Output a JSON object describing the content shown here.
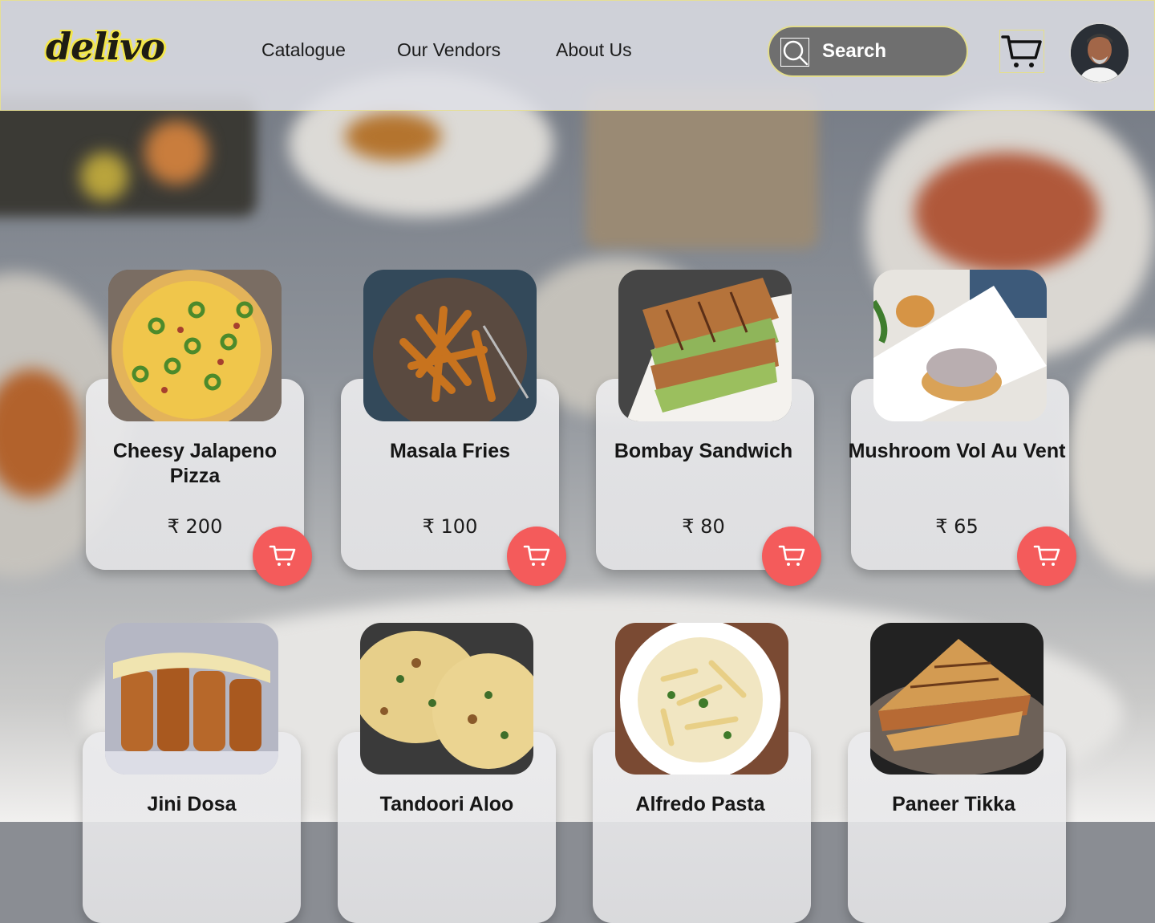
{
  "brand": {
    "logo_text": "delivo"
  },
  "nav": {
    "items": [
      {
        "label": "Catalogue"
      },
      {
        "label": "Our Vendors"
      },
      {
        "label": "About Us"
      }
    ]
  },
  "search": {
    "label": "Search",
    "icon": "search-icon"
  },
  "header_icons": {
    "cart": "cart-icon",
    "avatar": "user-avatar"
  },
  "colors": {
    "accent_yellow": "#f3e64a",
    "add_button": "#f45b5b",
    "search_bg": "#6f6f6f"
  },
  "products": [
    {
      "name": "Cheesy Jalapeno Pizza",
      "price": "₹ 200",
      "image": "pizza"
    },
    {
      "name": "Masala Fries",
      "price": "₹ 100",
      "image": "fries"
    },
    {
      "name": "Bombay Sandwich",
      "price": "₹ 80",
      "image": "sandwich"
    },
    {
      "name": "Mushroom Vol Au Vent",
      "price": "₹ 65",
      "image": "vol-au-vent"
    },
    {
      "name": "Jini Dosa",
      "image": "dosa"
    },
    {
      "name": "Tandoori Aloo",
      "image": "naan"
    },
    {
      "name": "Alfredo Pasta",
      "image": "pasta"
    },
    {
      "name": "Paneer Tikka",
      "image": "grilled-sandwich"
    }
  ]
}
